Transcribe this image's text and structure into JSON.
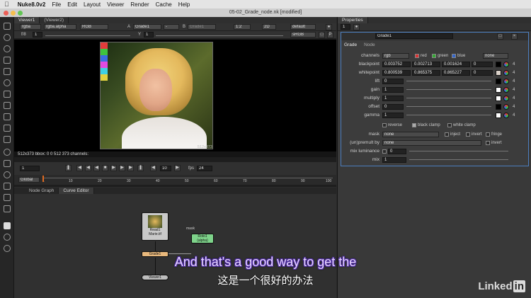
{
  "menubar": {
    "app": "Nuke8.0v2",
    "items": [
      "File",
      "Edit",
      "Layout",
      "Viewer",
      "Render",
      "Cache",
      "Help"
    ]
  },
  "window": {
    "title": "05-02_Grade_node.nk [modified]"
  },
  "viewer": {
    "tabs": [
      "Viewer1",
      "(Viewer2)"
    ],
    "channels": "rgba",
    "alpha": "rgba.alpha",
    "colorspace": "RGB",
    "input_a_label": "A",
    "input_a": "Grade1",
    "op": "-",
    "input_b_label": "B",
    "input_b": "Grade1",
    "zoom": "1:2",
    "view_mode": "2D",
    "lut": "default",
    "srgb": "sRGB",
    "fstop": "f/8",
    "frame_field": "1",
    "gain_field": "1",
    "y_label": "Y",
    "bbox_label": "512x373",
    "info": "512x373 bbox: 0 0 512 373 channels:",
    "frame": "1",
    "increment": "10",
    "fps_label": "fps",
    "fps": "24",
    "range_mode": "Global",
    "timeline_ticks": [
      "1",
      "10",
      "20",
      "30",
      "40",
      "50",
      "60",
      "70",
      "80",
      "90",
      "100"
    ]
  },
  "panels": {
    "bottom_tabs": [
      "Node Graph",
      "Curve Editor"
    ]
  },
  "properties": {
    "title": "Properties",
    "max_nodes": "1",
    "node_name": "Grade1",
    "tabs": [
      "Grade",
      "Node"
    ],
    "channels_label": "channels",
    "channels_value": "rgb",
    "channel_checks": [
      "red",
      "green",
      "blue"
    ],
    "channel_extra": "none",
    "params": [
      {
        "label": "blackpoint",
        "values": [
          "0.003752",
          "0.002713",
          "0.001624",
          "0"
        ]
      },
      {
        "label": "whitepoint",
        "values": [
          "0.800539",
          "0.865375",
          "0.865227",
          "0"
        ]
      },
      {
        "label": "lift",
        "values": [
          "0"
        ]
      },
      {
        "label": "gain",
        "values": [
          "1"
        ]
      },
      {
        "label": "multiply",
        "values": [
          "1"
        ]
      },
      {
        "label": "offset",
        "values": [
          "0"
        ]
      },
      {
        "label": "gamma",
        "values": [
          "1"
        ]
      }
    ],
    "reverse_label": "reverse",
    "black_clamp_label": "black clamp",
    "white_clamp_label": "white clamp",
    "mask_label": "mask",
    "mask_value": "none",
    "inject_label": "inject",
    "invert_label": "invert",
    "fringe_label": "fringe",
    "unpremult_label": "(un)premult by",
    "unpremult_value": "none",
    "invert2_label": "invert",
    "mix_luminance_label": "mix luminance",
    "mix_luminance_value": "0",
    "mix_label": "mix",
    "mix_value": "1",
    "channel_count": "4"
  },
  "nodegraph": {
    "read_label": "Read1",
    "read_file": "Marie.tif",
    "grade_label": "Grade1",
    "mask_input": "mask",
    "rotor_label": "Roto1",
    "rotor_sub": "(alpha)",
    "viewer_label": "Viewer1"
  },
  "overlay": {
    "subtitle_en": "And that's a good way to get the",
    "subtitle_cn": "这是一个很好的办法",
    "brand_main": "Linked",
    "brand_in": "in"
  }
}
